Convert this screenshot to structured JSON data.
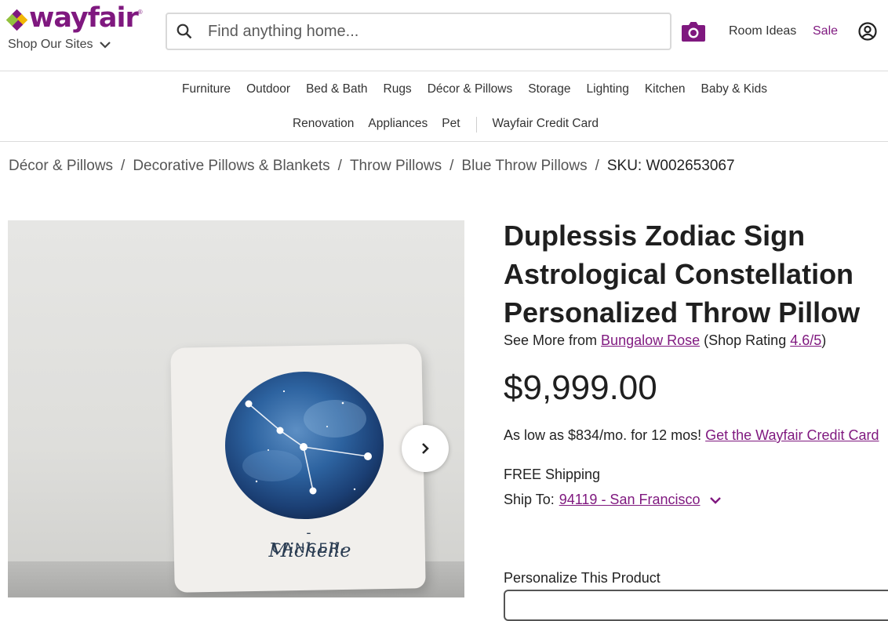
{
  "header": {
    "logo_text": "wayfair",
    "logo_mark": "®",
    "shop_sites": "Shop Our Sites",
    "search_placeholder": "Find anything home...",
    "room_ideas": "Room Ideas",
    "sale": "Sale",
    "icons": [
      "search-icon",
      "camera-icon",
      "account-icon",
      "chevron-down-icon"
    ]
  },
  "nav": {
    "row1": [
      "Furniture",
      "Outdoor",
      "Bed & Bath",
      "Rugs",
      "Décor & Pillows",
      "Storage",
      "Lighting",
      "Kitchen",
      "Baby & Kids"
    ],
    "row2": [
      "Renovation",
      "Appliances",
      "Pet",
      "Wayfair Credit Card"
    ]
  },
  "breadcrumb": {
    "items": [
      "Décor & Pillows",
      "Decorative Pillows & Blankets",
      "Throw Pillows",
      "Blue Throw Pillows"
    ],
    "separator": "/",
    "sku": "SKU: W002653067"
  },
  "image": {
    "zodiac_sign": "-CANCER-",
    "zodiac_name": "Michelle"
  },
  "product": {
    "title": "Duplessis Zodiac Sign Astrological Constellation Personalized Throw Pillow",
    "see_more_prefix": "See More from ",
    "brand": "Bungalow Rose",
    "rating_prefix": " (Shop Rating ",
    "rating": "4.6/5",
    "rating_suffix": ")",
    "price": "$9,999.00",
    "financing_text": "As low as $834/mo. for 12 mos! ",
    "financing_link": "Get the Wayfair Credit Card",
    "shipping": "FREE Shipping",
    "ship_to_label": "Ship To: ",
    "ship_to_value": "94119 - San Francisco",
    "personalize": "Personalize This Product"
  },
  "colors": {
    "brand": "#7f187f",
    "text": "#2b2b2b"
  }
}
